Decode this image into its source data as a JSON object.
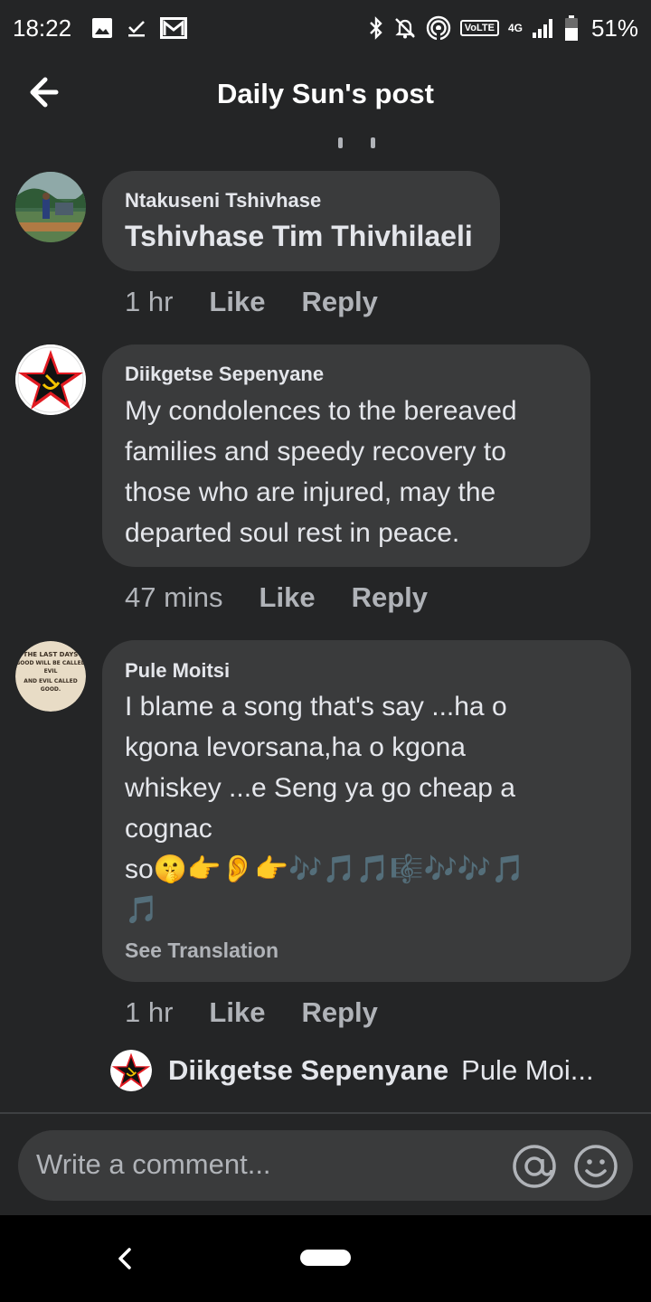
{
  "status_bar": {
    "time": "18:22",
    "volte": "VoLTE",
    "network": "4G",
    "battery": "51%",
    "icons": [
      "image-icon",
      "download-done-icon",
      "gmail-icon",
      "bluetooth-icon",
      "notifications-off-icon",
      "hotspot-icon",
      "signal-icon",
      "battery-icon"
    ]
  },
  "header": {
    "title": "Daily Sun's post",
    "back_icon": "arrow-left-icon"
  },
  "comments": [
    {
      "author": "Ntakuseni Tshivhase",
      "lines": [
        "Tshivhase Tim Thivhilaeli"
      ],
      "time": "1 hr",
      "like": "Like",
      "reply": "Reply"
    },
    {
      "author": "Diikgetse Sepenyane",
      "lines": [
        "My condolences to the bereaved",
        "families and speedy recovery to",
        "those who are injured, may the",
        "departed soul rest in peace."
      ],
      "time": "47 mins",
      "like": "Like",
      "reply": "Reply"
    },
    {
      "author": "Pule Moitsi",
      "lines": [
        "I blame a song that's say ...ha o",
        "kgona levorsana,ha o kgona",
        "whiskey ...e Seng ya go cheap a",
        "cognac",
        "so🤫👉👂👉🎶🎵🎵🎼🎶🎶🎵",
        "🎵"
      ],
      "see_translation": "See Translation",
      "time": "1 hr",
      "like": "Like",
      "reply": "Reply"
    }
  ],
  "reply_preview": {
    "name": "Diikgetse Sepenyane",
    "snippet": "Pule Moi..."
  },
  "avatar_badge_text": [
    "THE LAST DAYS",
    "GOOD WILL BE CALLED",
    "EVIL",
    "AND EVIL CALLED",
    "GOOD."
  ],
  "composer": {
    "placeholder": "Write a comment..."
  },
  "colors": {
    "background": "#242526",
    "bubble": "#3a3b3c",
    "text_primary": "#e4e6eb",
    "text_secondary": "#b0b3b8",
    "nav_bar": "#000000"
  }
}
